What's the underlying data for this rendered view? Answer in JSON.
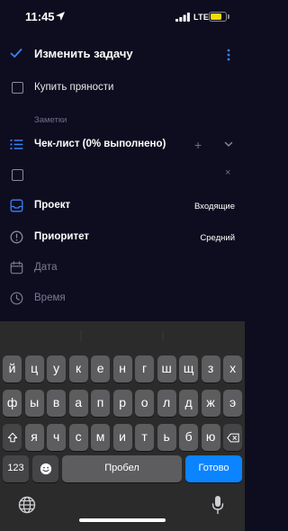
{
  "status_bar": {
    "time": "11:45",
    "network": "LTE",
    "battery_level": 0.8,
    "battery_color": "#f5d90a"
  },
  "header": {
    "title": "Изменить задачу"
  },
  "task": {
    "name": "Купить пряности"
  },
  "notes": {
    "label": "Заметки"
  },
  "checklist": {
    "title": "Чек-лист (0% выполнено)",
    "add_symbol": "+",
    "item_text": "",
    "remove_symbol": "×"
  },
  "project": {
    "label": "Проект",
    "value": "Входящие"
  },
  "priority": {
    "label": "Приоритет",
    "value": "Средний"
  },
  "date": {
    "label": "Дата"
  },
  "time_field": {
    "label": "Время"
  },
  "keyboard": {
    "row1": [
      "й",
      "ц",
      "у",
      "к",
      "е",
      "н",
      "г",
      "ш",
      "щ",
      "з",
      "х"
    ],
    "row2": [
      "ф",
      "ы",
      "в",
      "а",
      "п",
      "р",
      "о",
      "л",
      "д",
      "ж",
      "э"
    ],
    "row3": [
      "я",
      "ч",
      "с",
      "м",
      "и",
      "т",
      "ь",
      "б",
      "ю"
    ],
    "numbers_key": "123",
    "space_key": "Пробел",
    "done_key": "Готово"
  },
  "colors": {
    "accent": "#3b82f6",
    "background": "#0e0d1f",
    "done_key": "#0a84ff"
  }
}
